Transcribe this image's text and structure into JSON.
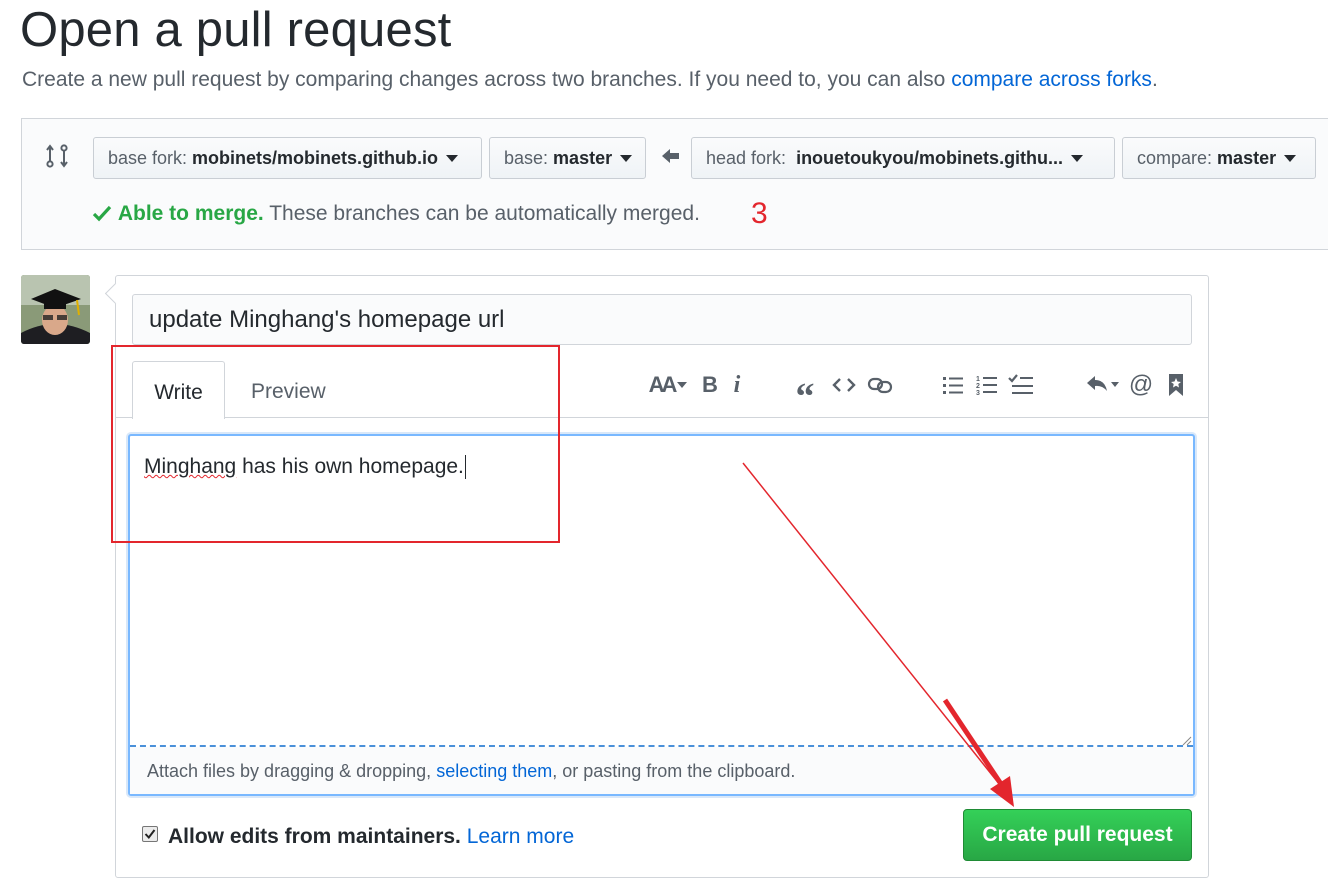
{
  "header": {
    "title": "Open a pull request",
    "subtitle_prefix": "Create a new pull request by comparing changes across two branches. If you need to, you can also ",
    "subtitle_link": "compare across forks",
    "subtitle_suffix": "."
  },
  "range": {
    "base_fork_label": "base fork:",
    "base_fork_value": "mobinets/mobinets.github.io",
    "base_label": "base:",
    "base_value": "master",
    "head_fork_label": "head fork:",
    "head_fork_value": "inouetoukyou/mobinets.githu...",
    "compare_label": "compare:",
    "compare_value": "master",
    "merge_ok": "Able to merge.",
    "merge_desc": "These branches can be automatically merged."
  },
  "annotation": {
    "step_number": "3"
  },
  "form": {
    "title_value": "update Minghang's homepage url",
    "tabs": [
      {
        "label": "Write",
        "active": true
      },
      {
        "label": "Preview",
        "active": false
      }
    ],
    "toolbar": {
      "heading": "AA",
      "bold": "B",
      "italic": "i",
      "quote": "“",
      "code": "<>",
      "mention": "@"
    },
    "body_misspelled": "Minghang",
    "body_rest": " has his own homepage.",
    "attach_prefix": "Attach files by dragging & dropping, ",
    "attach_link": "selecting them",
    "attach_suffix": ", or pasting from the clipboard.",
    "allow_edits_label": "Allow edits from maintainers.",
    "allow_edits_checked": true,
    "learn_more": "Learn more",
    "submit_label": "Create pull request"
  },
  "colors": {
    "link": "#0366d6",
    "success": "#28a745",
    "annotation": "#e3262d",
    "focus": "#79b8ff"
  }
}
